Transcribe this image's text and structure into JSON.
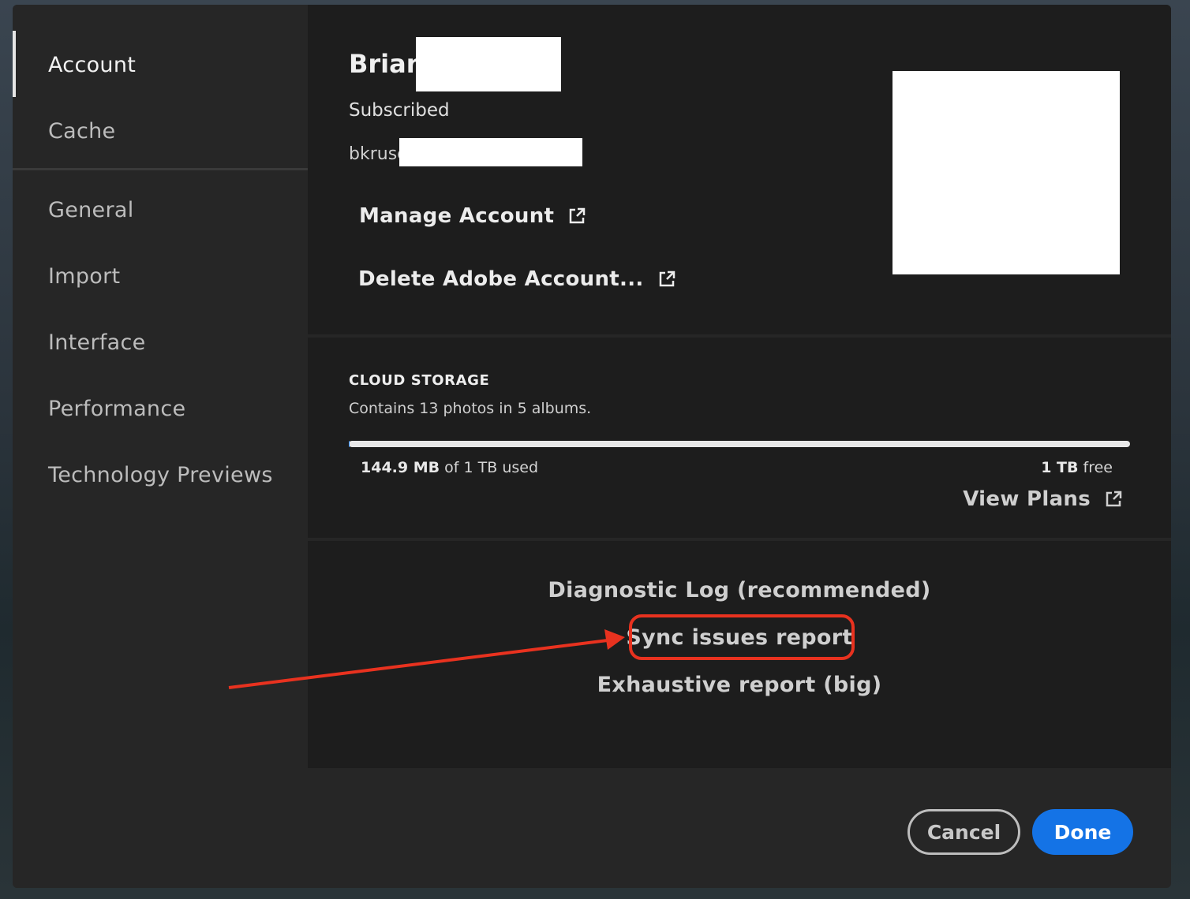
{
  "sidebar": {
    "items": [
      {
        "label": "Account",
        "active": true
      },
      {
        "label": "Cache",
        "active": false
      },
      {
        "label": "General",
        "active": false
      },
      {
        "label": "Import",
        "active": false
      },
      {
        "label": "Interface",
        "active": false
      },
      {
        "label": "Performance",
        "active": false
      },
      {
        "label": "Technology Previews",
        "active": false
      }
    ]
  },
  "account": {
    "name": "Brian",
    "status": "Subscribed",
    "email": "bkruse",
    "manage_label": "Manage Account",
    "delete_label": "Delete Adobe Account..."
  },
  "storage": {
    "title": "CLOUD STORAGE",
    "description": "Contains 13 photos in 5 albums.",
    "used_amount": "144.9 MB",
    "used_suffix": "of 1 TB used",
    "free_amount": "1 TB",
    "free_suffix": "free",
    "used_fraction": 0.0001,
    "view_plans_label": "View Plans"
  },
  "diagnostics": {
    "log_label": "Diagnostic Log (recommended)",
    "sync_label": "Sync issues report",
    "exhaustive_label": "Exhaustive report (big)"
  },
  "footer": {
    "cancel_label": "Cancel",
    "done_label": "Done"
  },
  "colors": {
    "accent": "#1473e6",
    "annotation": "#e8321f"
  },
  "icons": {
    "external_link": "external-link-icon"
  }
}
